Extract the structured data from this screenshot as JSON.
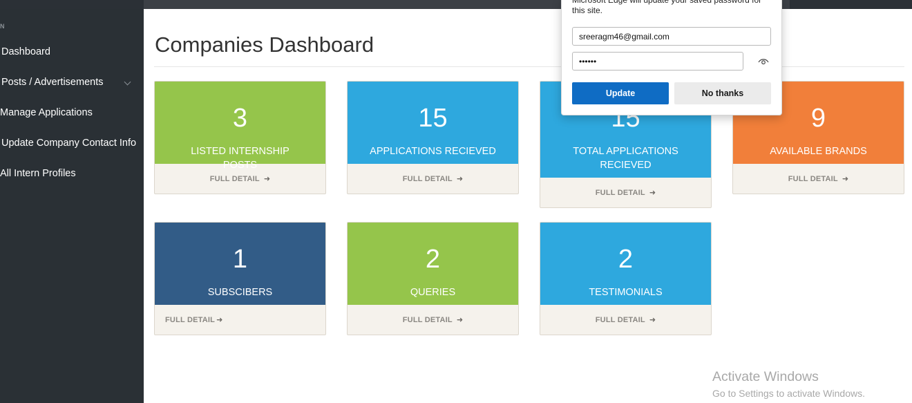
{
  "sidebar": {
    "heading": "N",
    "items": [
      {
        "label": "Dashboard"
      },
      {
        "label": "Posts / Advertisements"
      },
      {
        "label": "Manage Applications"
      },
      {
        "label": "Update Company Contact Info"
      },
      {
        "label": "All Intern Profiles"
      }
    ]
  },
  "main": {
    "title": "Companies Dashboard",
    "cards": [
      {
        "value": "3",
        "label": "LISTED INTERNSHIP POSTS",
        "link": "FULL DETAIL",
        "color": "#95c54b"
      },
      {
        "value": "15",
        "label": "APPLICATIONS RECIEVED",
        "link": "FULL DETAIL",
        "color": "#2ea8de"
      },
      {
        "value": "15",
        "label": "TOTAL APPLICATIONS RECIEVED",
        "link": "FULL DETAIL",
        "color": "#2ea8de"
      },
      {
        "value": "9",
        "label": "AVAILABLE BRANDS",
        "link": "FULL DETAIL",
        "color": "#f17f3a"
      },
      {
        "value": "1",
        "label": "SUBSCIBERS",
        "link": "FULL DETAIL",
        "color": "#325c87"
      },
      {
        "value": "2",
        "label": "QUERIES",
        "link": "FULL DETAIL",
        "color": "#95c54b"
      },
      {
        "value": "2",
        "label": "TESTIMONIALS",
        "link": "FULL DETAIL",
        "color": "#2ea8de"
      }
    ]
  },
  "password_popup": {
    "message": "Microsoft Edge will update your saved password for this site.",
    "username": "sreeragm46@gmail.com",
    "password_masked": "••••••",
    "update_label": "Update",
    "no_thanks_label": "No thanks"
  },
  "watermark": {
    "title": "Activate Windows",
    "subtitle": "Go to Settings to activate Windows."
  },
  "icons": {
    "arrow": "arrow-right-icon",
    "eye": "eye-icon",
    "chevron": "chevron-down-icon"
  }
}
